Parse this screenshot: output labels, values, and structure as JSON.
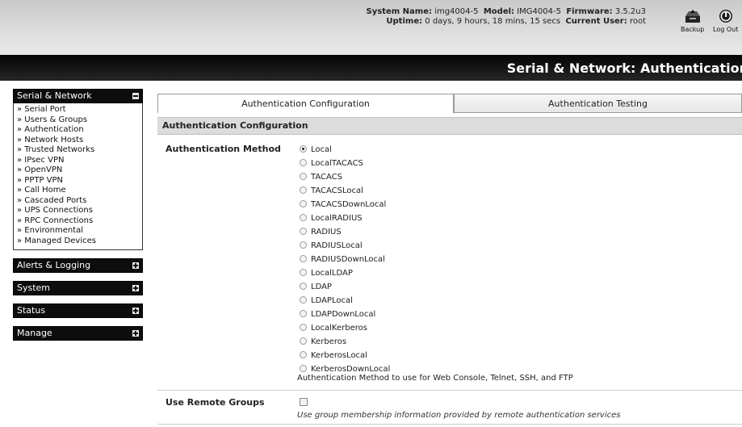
{
  "header": {
    "system_name_label": "System Name:",
    "system_name": "img4004-5",
    "model_label": "Model:",
    "model": "IMG4004-5",
    "firmware_label": "Firmware:",
    "firmware": "3.5.2u3",
    "uptime_label": "Uptime:",
    "uptime": "0 days, 9 hours, 18 mins, 15 secs",
    "current_user_label": "Current User:",
    "current_user": "root",
    "backup_label": "Backup",
    "logout_label": "Log Out",
    "backup_icon": "backup-icon",
    "logout_icon": "power-icon"
  },
  "page_title": "Serial & Network: Authentication",
  "sidebar": {
    "sections": [
      {
        "title": "Serial & Network",
        "expanded": true,
        "items": [
          "» Serial Port",
          "» Users & Groups",
          "» Authentication",
          "» Network Hosts",
          "» Trusted Networks",
          "» IPsec VPN",
          "» OpenVPN",
          "» PPTP VPN",
          "» Call Home",
          "» Cascaded Ports",
          "» UPS Connections",
          "» RPC Connections",
          "» Environmental",
          "» Managed Devices"
        ]
      },
      {
        "title": "Alerts & Logging",
        "expanded": false
      },
      {
        "title": "System",
        "expanded": false
      },
      {
        "title": "Status",
        "expanded": false
      },
      {
        "title": "Manage",
        "expanded": false
      }
    ]
  },
  "tabs": [
    {
      "label": "Authentication Configuration",
      "active": true
    },
    {
      "label": "Authentication Testing",
      "active": false
    }
  ],
  "config": {
    "section_title": "Authentication Configuration",
    "method_label": "Authentication Method",
    "methods": [
      "Local",
      "LocalTACACS",
      "TACACS",
      "TACACSLocal",
      "TACACSDownLocal",
      "LocalRADIUS",
      "RADIUS",
      "RADIUSLocal",
      "RADIUSDownLocal",
      "LocalLDAP",
      "LDAP",
      "LDAPLocal",
      "LDAPDownLocal",
      "LocalKerberos",
      "Kerberos",
      "KerberosLocal",
      "KerberosDownLocal"
    ],
    "selected_method": "Local",
    "method_help": "Authentication Method to use for Web Console, Telnet, SSH, and FTP",
    "remote_groups_label": "Use Remote Groups",
    "remote_groups_checked": false,
    "remote_groups_help": "Use group membership information provided by remote authentication services"
  }
}
